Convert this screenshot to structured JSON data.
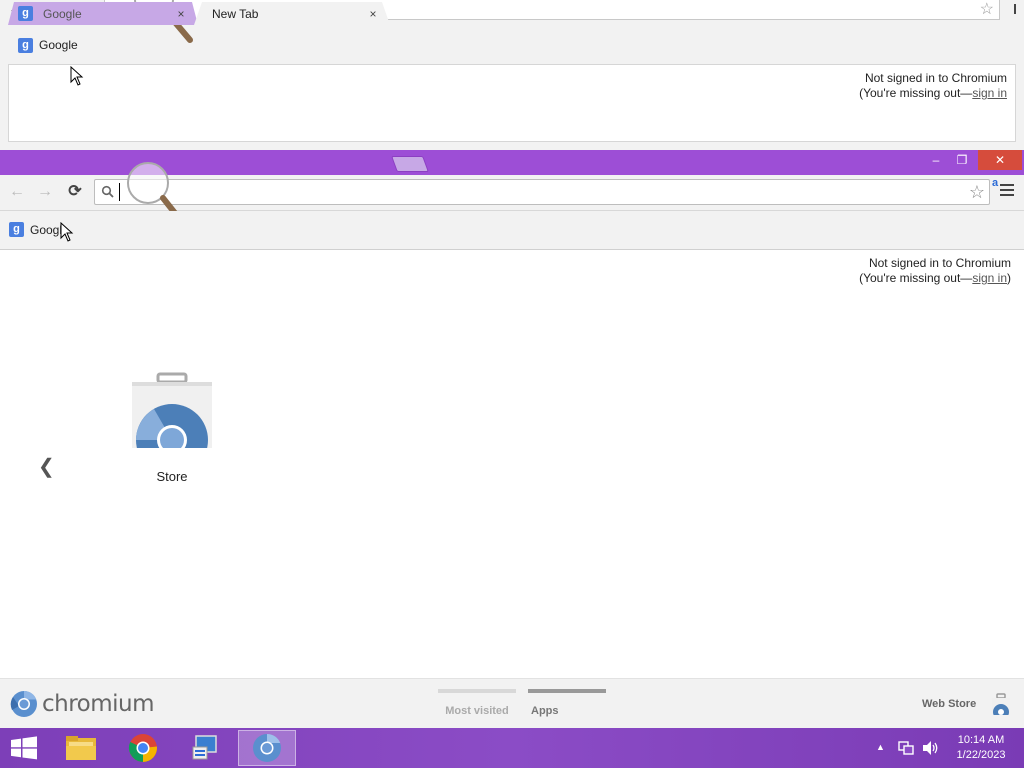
{
  "background_window": {
    "bookmark_label": "Google",
    "signin_line1": "Not signed in to Chromium",
    "signin_line2_prefix": "(You're missing out—",
    "signin_link": "sign in",
    "signin_suffix": ""
  },
  "tabs": [
    {
      "title": "Google",
      "close": "×",
      "active": false
    },
    {
      "title": "New Tab",
      "close": "×",
      "active": true
    }
  ],
  "window_controls": {
    "minimize": "–",
    "restore": "❐",
    "close": "✕"
  },
  "toolbar": {
    "omnibox_value": "",
    "omnibox_placeholder": "",
    "ext_label": "a"
  },
  "bookmarks": [
    {
      "label": "Google",
      "favicon": "G"
    }
  ],
  "ntp": {
    "signin_line1": "Not signed in to Chromium",
    "signin_line2_prefix": "(You're missing out—",
    "signin_link": "sign in",
    "signin_suffix": ")",
    "prev_arrow": "❮",
    "apps": [
      {
        "label": "Store"
      }
    ],
    "footer": {
      "brand": "chromium",
      "page_switches": [
        {
          "label": "Most visited",
          "active": false
        },
        {
          "label": "Apps",
          "active": true
        }
      ],
      "webstore_label": "Web Store"
    }
  },
  "taskbar": {
    "clock_time": "10:14 AM",
    "clock_date": "1/22/2023",
    "items": [
      "file-explorer",
      "chrome",
      "control-panel",
      "chromium"
    ]
  },
  "colors": {
    "accent": "#9d4ed6",
    "taskbar": "#8b4cc6",
    "close": "#d64c3c"
  }
}
